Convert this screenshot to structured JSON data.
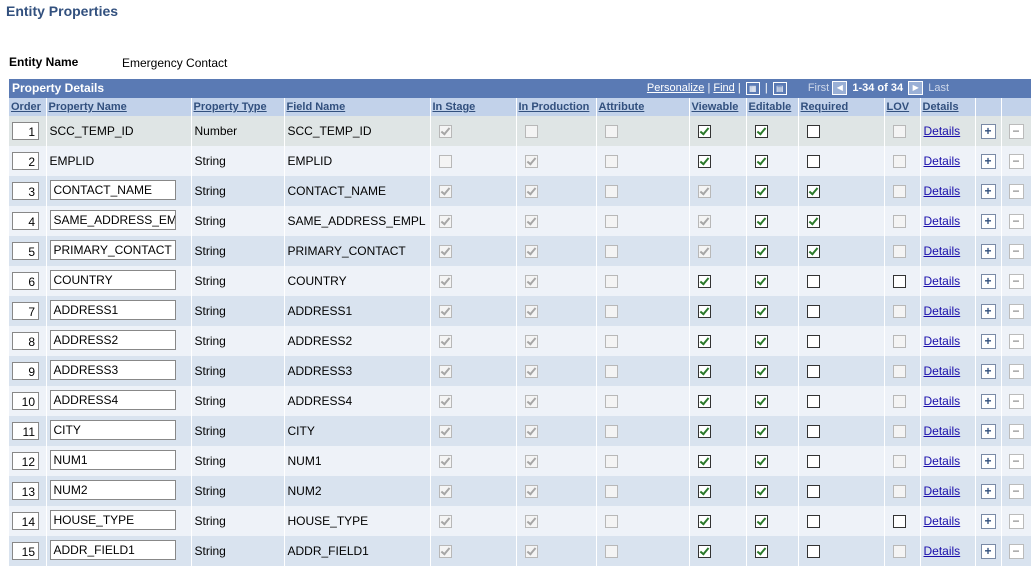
{
  "page": {
    "title": "Entity Properties"
  },
  "entity": {
    "label": "Entity Name",
    "value": "Emergency Contact"
  },
  "grid": {
    "title": "Property Details",
    "nav": {
      "personalize": "Personalize",
      "find": "Find",
      "first": "First",
      "range": "1-34 of 34",
      "last": "Last"
    },
    "columns": {
      "order": "Order",
      "property_name": "Property Name",
      "property_type": "Property Type",
      "field_name": "Field Name",
      "in_stage": "In Stage",
      "in_production": "In Production",
      "attribute": "Attribute",
      "viewable": "Viewable",
      "editable": "Editable",
      "required": "Required",
      "lov": "LOV",
      "details": "Details"
    },
    "details_link": "Details",
    "add_icon": "plus-icon",
    "delete_icon": "minus-icon",
    "rows": [
      {
        "order": "1",
        "name": "SCC_TEMP_ID",
        "name_editable": false,
        "type": "Number",
        "field": "SCC_TEMP_ID",
        "in_stage": true,
        "in_production": false,
        "attribute": false,
        "viewable": true,
        "viewable_enabled": true,
        "editable": true,
        "required": false,
        "required_enabled": true,
        "lov": false,
        "lov_enabled": false
      },
      {
        "order": "2",
        "name": "EMPLID",
        "name_editable": false,
        "type": "String",
        "field": "EMPLID",
        "in_stage": false,
        "in_production": true,
        "attribute": false,
        "viewable": true,
        "viewable_enabled": true,
        "editable": true,
        "required": false,
        "required_enabled": true,
        "lov": false,
        "lov_enabled": false
      },
      {
        "order": "3",
        "name": "CONTACT_NAME",
        "name_editable": true,
        "type": "String",
        "field": "CONTACT_NAME",
        "in_stage": true,
        "in_production": true,
        "attribute": false,
        "viewable": true,
        "viewable_enabled": false,
        "editable": true,
        "required": true,
        "required_enabled": true,
        "lov": false,
        "lov_enabled": false
      },
      {
        "order": "4",
        "name": "SAME_ADDRESS_EMPL",
        "name_editable": true,
        "type": "String",
        "field": "SAME_ADDRESS_EMPL",
        "in_stage": true,
        "in_production": true,
        "attribute": false,
        "viewable": true,
        "viewable_enabled": false,
        "editable": true,
        "required": true,
        "required_enabled": true,
        "lov": false,
        "lov_enabled": false
      },
      {
        "order": "5",
        "name": "PRIMARY_CONTACT",
        "name_editable": true,
        "type": "String",
        "field": "PRIMARY_CONTACT",
        "in_stage": true,
        "in_production": true,
        "attribute": false,
        "viewable": true,
        "viewable_enabled": false,
        "editable": true,
        "required": true,
        "required_enabled": true,
        "lov": false,
        "lov_enabled": false
      },
      {
        "order": "6",
        "name": "COUNTRY",
        "name_editable": true,
        "type": "String",
        "field": "COUNTRY",
        "in_stage": true,
        "in_production": true,
        "attribute": false,
        "viewable": true,
        "viewable_enabled": true,
        "editable": true,
        "required": false,
        "required_enabled": true,
        "lov": false,
        "lov_enabled": true
      },
      {
        "order": "7",
        "name": "ADDRESS1",
        "name_editable": true,
        "type": "String",
        "field": "ADDRESS1",
        "in_stage": true,
        "in_production": true,
        "attribute": false,
        "viewable": true,
        "viewable_enabled": true,
        "editable": true,
        "required": false,
        "required_enabled": true,
        "lov": false,
        "lov_enabled": false
      },
      {
        "order": "8",
        "name": "ADDRESS2",
        "name_editable": true,
        "type": "String",
        "field": "ADDRESS2",
        "in_stage": true,
        "in_production": true,
        "attribute": false,
        "viewable": true,
        "viewable_enabled": true,
        "editable": true,
        "required": false,
        "required_enabled": true,
        "lov": false,
        "lov_enabled": false
      },
      {
        "order": "9",
        "name": "ADDRESS3",
        "name_editable": true,
        "type": "String",
        "field": "ADDRESS3",
        "in_stage": true,
        "in_production": true,
        "attribute": false,
        "viewable": true,
        "viewable_enabled": true,
        "editable": true,
        "required": false,
        "required_enabled": true,
        "lov": false,
        "lov_enabled": false
      },
      {
        "order": "10",
        "name": "ADDRESS4",
        "name_editable": true,
        "type": "String",
        "field": "ADDRESS4",
        "in_stage": true,
        "in_production": true,
        "attribute": false,
        "viewable": true,
        "viewable_enabled": true,
        "editable": true,
        "required": false,
        "required_enabled": true,
        "lov": false,
        "lov_enabled": false
      },
      {
        "order": "11",
        "name": "CITY",
        "name_editable": true,
        "type": "String",
        "field": "CITY",
        "in_stage": true,
        "in_production": true,
        "attribute": false,
        "viewable": true,
        "viewable_enabled": true,
        "editable": true,
        "required": false,
        "required_enabled": true,
        "lov": false,
        "lov_enabled": false
      },
      {
        "order": "12",
        "name": "NUM1",
        "name_editable": true,
        "type": "String",
        "field": "NUM1",
        "in_stage": true,
        "in_production": true,
        "attribute": false,
        "viewable": true,
        "viewable_enabled": true,
        "editable": true,
        "required": false,
        "required_enabled": true,
        "lov": false,
        "lov_enabled": false
      },
      {
        "order": "13",
        "name": "NUM2",
        "name_editable": true,
        "type": "String",
        "field": "NUM2",
        "in_stage": true,
        "in_production": true,
        "attribute": false,
        "viewable": true,
        "viewable_enabled": true,
        "editable": true,
        "required": false,
        "required_enabled": true,
        "lov": false,
        "lov_enabled": false
      },
      {
        "order": "14",
        "name": "HOUSE_TYPE",
        "name_editable": true,
        "type": "String",
        "field": "HOUSE_TYPE",
        "in_stage": true,
        "in_production": true,
        "attribute": false,
        "viewable": true,
        "viewable_enabled": true,
        "editable": true,
        "required": false,
        "required_enabled": true,
        "lov": false,
        "lov_enabled": true
      },
      {
        "order": "15",
        "name": "ADDR_FIELD1",
        "name_editable": true,
        "type": "String",
        "field": "ADDR_FIELD1",
        "in_stage": true,
        "in_production": true,
        "attribute": false,
        "viewable": true,
        "viewable_enabled": true,
        "editable": true,
        "required": false,
        "required_enabled": true,
        "lov": false,
        "lov_enabled": false
      }
    ]
  }
}
